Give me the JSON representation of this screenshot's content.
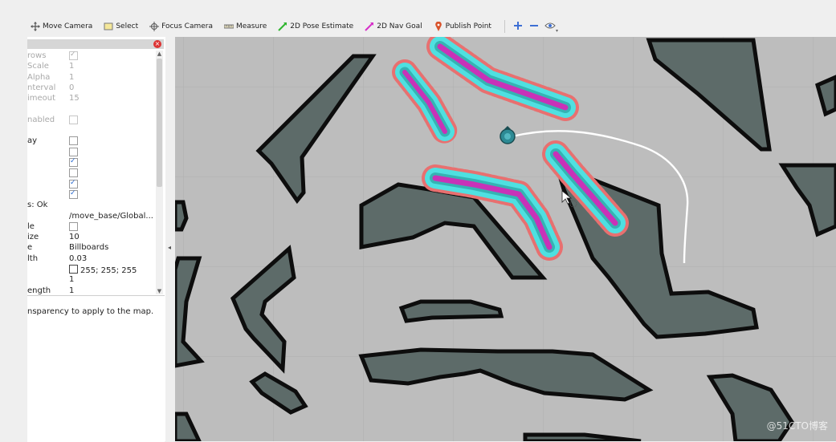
{
  "toolbar": {
    "tools": [
      {
        "label": "Move Camera",
        "icon": "move-icon"
      },
      {
        "label": "Select",
        "icon": "select-icon"
      },
      {
        "label": "Focus Camera",
        "icon": "focus-icon"
      },
      {
        "label": "Measure",
        "icon": "ruler-icon"
      },
      {
        "label": "2D Pose Estimate",
        "icon": "green-arrow-icon"
      },
      {
        "label": "2D Nav Goal",
        "icon": "pink-arrow-icon"
      },
      {
        "label": "Publish Point",
        "icon": "map-pin-icon"
      }
    ]
  },
  "panel": {
    "props": [
      {
        "name": "rows",
        "value": "",
        "check": true,
        "dim": true
      },
      {
        "name": "Scale",
        "value": "1",
        "dim": true
      },
      {
        "name": "Alpha",
        "value": "1",
        "dim": true
      },
      {
        "name": "nterval",
        "value": "0",
        "dim": true
      },
      {
        "name": "imeout",
        "value": "15",
        "dim": true
      },
      {
        "name": "",
        "value": ""
      },
      {
        "name": "nabled",
        "value": "",
        "check": false,
        "dim": true
      },
      {
        "name": "",
        "value": ""
      },
      {
        "name": "ay",
        "value": "",
        "check": false
      },
      {
        "name": "",
        "value": "",
        "check": false
      },
      {
        "name": "",
        "value": "",
        "check": true
      },
      {
        "name": "",
        "value": "",
        "check": false
      },
      {
        "name": "",
        "value": "",
        "check": true
      },
      {
        "name": "",
        "value": "",
        "check": true
      },
      {
        "name": "s: Ok",
        "value": ""
      },
      {
        "name": "",
        "value": "/move_base/Global..."
      },
      {
        "name": "le",
        "value": "",
        "check": false
      },
      {
        "name": "ize",
        "value": "10"
      },
      {
        "name": "e",
        "value": "Billboards"
      },
      {
        "name": "lth",
        "value": "0.03"
      },
      {
        "name": "",
        "value": "255; 255; 255",
        "swatch": true
      },
      {
        "name": "",
        "value": "1"
      },
      {
        "name": "ength",
        "value": "1"
      }
    ],
    "description": "nsparency to apply to the map."
  },
  "colors": {
    "map_bg": "#bdbdbd",
    "obstacle_fill": "#5d6b69",
    "obstacle_edge": "#0d0d0d",
    "inflation_cyan": "#4fe0e0",
    "inflation_magenta": "#c832b8",
    "inflation_red": "#e06464",
    "path": "#ffffff",
    "robot": "#2d8a94"
  },
  "watermark": "@51CTO博客"
}
